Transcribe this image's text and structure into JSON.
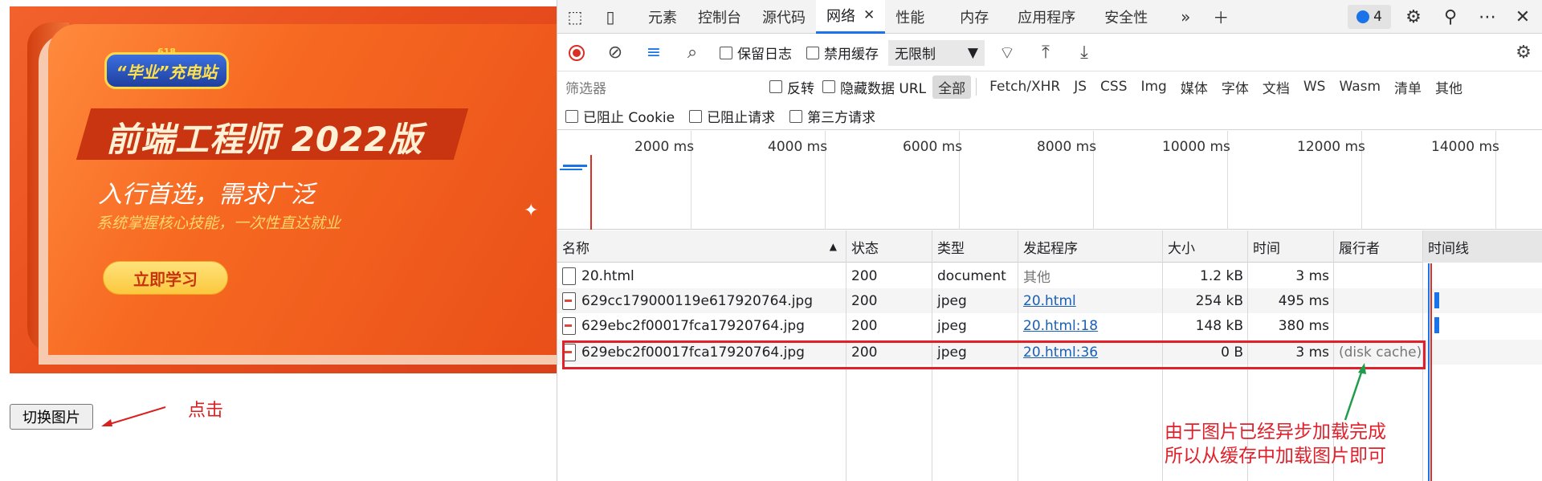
{
  "banner": {
    "badge_top": "618",
    "badge": "“毕业”充电站",
    "title": "前端工程师 2022版",
    "subtitle": "入行首选，需求广泛",
    "tagline": "系统掌握核心技能，一次性直达就业",
    "cta": "立即学习"
  },
  "page": {
    "switch_button": "切换图片",
    "click_note": "点击"
  },
  "devtools": {
    "tabs": [
      "元素",
      "控制台",
      "源代码",
      "网络",
      "性能",
      "内存",
      "应用程序",
      "安全性"
    ],
    "active_tab": "网络",
    "issues_count": "4",
    "toolbar": {
      "preserve_log": "保留日志",
      "disable_cache": "禁用缓存",
      "throttle": "无限制"
    },
    "filter": {
      "placeholder": "筛选器",
      "invert": "反转",
      "hide_data_urls": "隐藏数据 URL",
      "types": [
        "全部",
        "Fetch/XHR",
        "JS",
        "CSS",
        "Img",
        "媒体",
        "字体",
        "文档",
        "WS",
        "Wasm",
        "清单",
        "其他"
      ],
      "active_type": "全部",
      "blocked_cookies": "已阻止 Cookie",
      "blocked_requests": "已阻止请求",
      "third_party": "第三方请求"
    },
    "overview_ticks": [
      "2000 ms",
      "4000 ms",
      "6000 ms",
      "8000 ms",
      "10000 ms",
      "12000 ms",
      "14000 ms"
    ],
    "columns": [
      "名称",
      "状态",
      "类型",
      "发起程序",
      "大小",
      "时间",
      "履行者",
      "时间线"
    ],
    "rows": [
      {
        "name": "20.html",
        "status": "200",
        "type": "document",
        "initiator": "其他",
        "size": "1.2 kB",
        "time": "3 ms",
        "fulfilled": ""
      },
      {
        "name": "629cc179000119e617920764.jpg",
        "status": "200",
        "type": "jpeg",
        "initiator": "20.html",
        "size": "254 kB",
        "time": "495 ms",
        "fulfilled": ""
      },
      {
        "name": "629ebc2f00017fca17920764.jpg",
        "status": "200",
        "type": "jpeg",
        "initiator": "20.html:18",
        "size": "148 kB",
        "time": "380 ms",
        "fulfilled": ""
      },
      {
        "name": "629ebc2f00017fca17920764.jpg",
        "status": "200",
        "type": "jpeg",
        "initiator": "20.html:36",
        "size": "0 B",
        "time": "3 ms",
        "fulfilled": "(disk cache)"
      }
    ]
  },
  "annotation": {
    "line1": "由于图片已经异步加载完成",
    "line2": "所以从缓存中加载图片即可",
    "color": "#e0212b"
  }
}
